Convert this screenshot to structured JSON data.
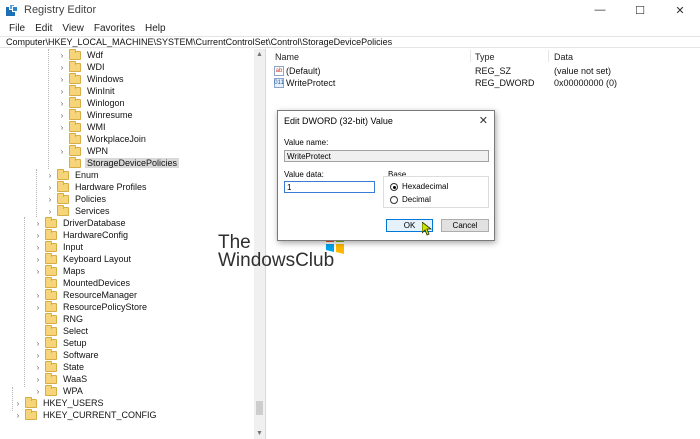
{
  "window": {
    "title": "Registry Editor",
    "min_glyph": "—",
    "max_glyph": "☐",
    "close_glyph": "✕"
  },
  "menu": {
    "items": [
      "File",
      "Edit",
      "View",
      "Favorites",
      "Help"
    ]
  },
  "address": {
    "path": "Computer\\HKEY_LOCAL_MACHINE\\SYSTEM\\CurrentControlSet\\Control\\StorageDevicePolicies"
  },
  "tree": {
    "items": [
      {
        "label": "Wdf",
        "expander": "›",
        "selected": false
      },
      {
        "label": "WDI",
        "expander": "›",
        "selected": false
      },
      {
        "label": "Windows",
        "expander": "›",
        "selected": false
      },
      {
        "label": "WinInit",
        "expander": "›",
        "selected": false
      },
      {
        "label": "Winlogon",
        "expander": "›",
        "selected": false
      },
      {
        "label": "Winresume",
        "expander": "›",
        "selected": false
      },
      {
        "label": "WMI",
        "expander": "›",
        "selected": false
      },
      {
        "label": "WorkplaceJoin",
        "expander": "",
        "selected": false
      },
      {
        "label": "WPN",
        "expander": "›",
        "selected": false
      },
      {
        "label": "StorageDevicePolicies",
        "expander": "",
        "selected": true
      },
      {
        "label": "Enum",
        "expander": "›",
        "selected": false
      },
      {
        "label": "Hardware Profiles",
        "expander": "›",
        "selected": false
      },
      {
        "label": "Policies",
        "expander": "›",
        "selected": false
      },
      {
        "label": "Services",
        "expander": "›",
        "selected": false
      },
      {
        "label": "DriverDatabase",
        "expander": "›",
        "selected": false
      },
      {
        "label": "HardwareConfig",
        "expander": "›",
        "selected": false
      },
      {
        "label": "Input",
        "expander": "›",
        "selected": false
      },
      {
        "label": "Keyboard Layout",
        "expander": "›",
        "selected": false
      },
      {
        "label": "Maps",
        "expander": "›",
        "selected": false
      },
      {
        "label": "MountedDevices",
        "expander": "",
        "selected": false
      },
      {
        "label": "ResourceManager",
        "expander": "›",
        "selected": false
      },
      {
        "label": "ResourcePolicyStore",
        "expander": "›",
        "selected": false
      },
      {
        "label": "RNG",
        "expander": "",
        "selected": false
      },
      {
        "label": "Select",
        "expander": "",
        "selected": false
      },
      {
        "label": "Setup",
        "expander": "›",
        "selected": false
      },
      {
        "label": "Software",
        "expander": "›",
        "selected": false
      },
      {
        "label": "State",
        "expander": "›",
        "selected": false
      },
      {
        "label": "WaaS",
        "expander": "›",
        "selected": false
      },
      {
        "label": "WPA",
        "expander": "›",
        "selected": false
      },
      {
        "label": "HKEY_USERS",
        "expander": "›",
        "selected": false
      },
      {
        "label": "HKEY_CURRENT_CONFIG",
        "expander": "›",
        "selected": false
      }
    ]
  },
  "values": {
    "headers": {
      "name": "Name",
      "type": "Type",
      "data": "Data"
    },
    "rows": [
      {
        "name": "(Default)",
        "type": "REG_SZ",
        "data": "(value not set)",
        "icon": "ab"
      },
      {
        "name": "WriteProtect",
        "type": "REG_DWORD",
        "data": "0x00000000 (0)",
        "icon": "011"
      }
    ]
  },
  "dialog": {
    "title": "Edit DWORD (32-bit) Value",
    "close_glyph": "✕",
    "value_name_label": "Value name:",
    "value_name": "WriteProtect",
    "value_data_label": "Value data:",
    "value_data": "1",
    "base_label": "Base",
    "hex_label": "Hexadecimal",
    "dec_label": "Decimal",
    "base_selected": "Hexadecimal",
    "ok_label": "OK",
    "cancel_label": "Cancel"
  },
  "watermark": {
    "line1": "The",
    "line2": "WindowsClub"
  },
  "scrollbar": {
    "up": "▲",
    "down": "▼"
  },
  "colors": {
    "selection": "#d9d9d9",
    "folder": "#f6d57a",
    "dialog_default_button": "#0078d7",
    "logo_red": "#f25022",
    "logo_green": "#7fba00",
    "logo_blue": "#00a4ef",
    "logo_yellow": "#ffb900"
  }
}
